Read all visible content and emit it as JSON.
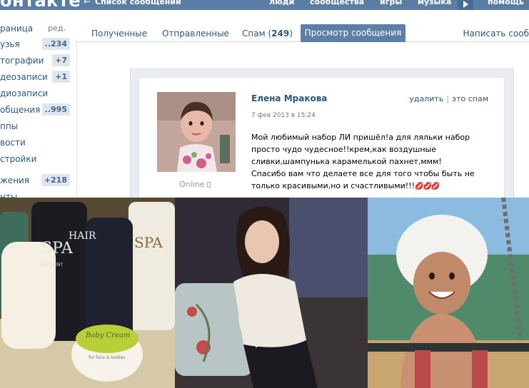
{
  "header": {
    "logo": "онтакте",
    "back_link": "Список сообщений",
    "nav": [
      "люди",
      "сообщества",
      "игры",
      "музыка"
    ],
    "help": "помощь"
  },
  "leftmenu": {
    "edit_label": "ред.",
    "items": [
      {
        "label": "раница",
        "badge": ""
      },
      {
        "label": "узья",
        "badge": "..234"
      },
      {
        "label": "тографии",
        "badge": "+7"
      },
      {
        "label": "деозаписи",
        "badge": "+1"
      },
      {
        "label": "диозаписи",
        "badge": ""
      },
      {
        "label": "общения",
        "badge": "..995"
      },
      {
        "label": "ппы",
        "badge": ""
      },
      {
        "label": "вости",
        "badge": ""
      },
      {
        "label": "стройки",
        "badge": ""
      },
      {
        "label": "жения",
        "badge": "+218"
      },
      {
        "label": "нты",
        "badge": ""
      }
    ]
  },
  "tabs": {
    "received": "Полученные",
    "sent": "Отправленные",
    "spam_label": "Спам (",
    "spam_count": "249",
    "spam_close": ")",
    "view": "Просмотр сообщения",
    "write": "Написать сооб"
  },
  "message": {
    "author": "Елена Мракова",
    "date": "7 фев 2013 в 15:24",
    "delete": "удалить",
    "spam": "это спам",
    "online": "Online",
    "lines": [
      "Мой любимый набор ЛИ пришёл!а для ляльки набор",
      "просто чудо чудесное!!крем,как воздушные",
      "сливки,шампунька карамелькой пахнет,ммм!",
      "Спасибо вам что делаете все для того чтобы быть не",
      "только красивыми,но и счастливыми!!!"
    ],
    "emoji": "💋💋💋"
  },
  "photos": {
    "product_labels": [
      "SPA",
      "HAIR",
      "TREATMENT",
      "SPA",
      "Baby Cream",
      "for face & bodies"
    ]
  },
  "colors": {
    "header_blue": "#597da3",
    "link_blue": "#2b587a",
    "active_tab": "#5b7fa6",
    "badge_bg": "#dfe6ee"
  }
}
